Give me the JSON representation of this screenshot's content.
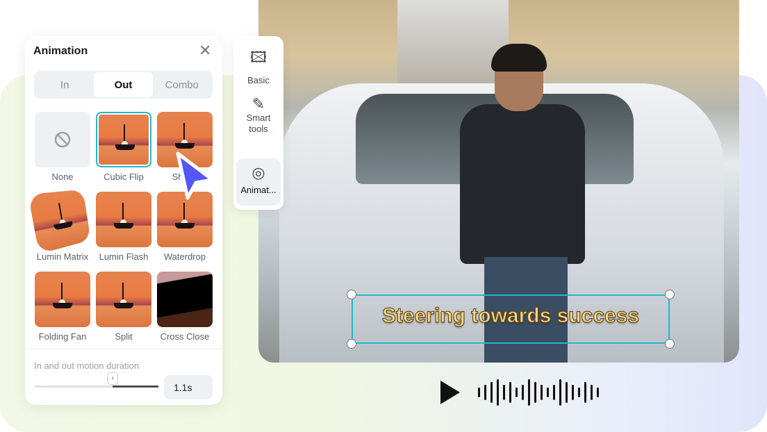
{
  "panel": {
    "title": "Animation",
    "close_icon": "close-icon",
    "tabs": [
      {
        "label": "In"
      },
      {
        "label": "Out"
      },
      {
        "label": "Combo"
      }
    ],
    "active_tab": "Out",
    "effects": [
      {
        "label": "None"
      },
      {
        "label": "Cubic Flip"
      },
      {
        "label": "Shake"
      },
      {
        "label": "Lumin Matrix"
      },
      {
        "label": "Lumin Flash"
      },
      {
        "label": "Waterdrop"
      },
      {
        "label": "Folding Fan"
      },
      {
        "label": "Split"
      },
      {
        "label": "Cross Close"
      }
    ],
    "selected_effect": "Cubic Flip",
    "duration": {
      "label": "In and out motion duration",
      "value": "1.1s",
      "slider_fraction": 0.63
    }
  },
  "sidebar": {
    "items": [
      {
        "label": "Basic",
        "icon": "image-icon"
      },
      {
        "label": "Smart tools",
        "icon": "magic-wand-icon"
      },
      {
        "label": "Animat...",
        "icon": "animation-icon"
      }
    ]
  },
  "canvas": {
    "caption": "Steering towards success"
  },
  "colors": {
    "accent": "#1fb8d0",
    "cursor": "#5457f5"
  }
}
